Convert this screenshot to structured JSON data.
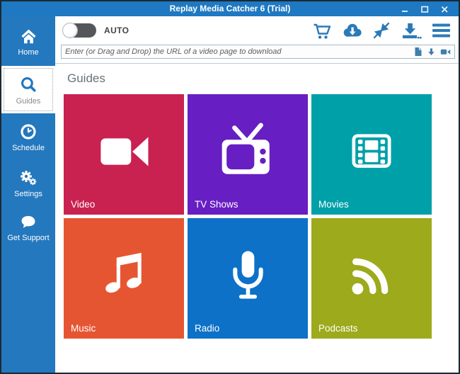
{
  "window": {
    "title": "Replay Media Catcher 6 (Trial)",
    "controls": [
      "minimize",
      "maximize",
      "close"
    ]
  },
  "sidebar": {
    "items": [
      {
        "label": "Home",
        "icon": "home-icon",
        "selected": false
      },
      {
        "label": "Guides",
        "icon": "search-icon",
        "selected": true
      },
      {
        "label": "Schedule",
        "icon": "clock-icon",
        "selected": false
      },
      {
        "label": "Settings",
        "icon": "gears-icon",
        "selected": false
      },
      {
        "label": "Get Support",
        "icon": "speech-bubble-icon",
        "selected": false
      }
    ]
  },
  "toolbar": {
    "auto_label": "AUTO",
    "auto_toggle_on": false,
    "icons": [
      "shopping-cart-icon",
      "cloud-download-icon",
      "shrink-arrows-icon",
      "download-tray-icon",
      "hamburger-menu-icon"
    ]
  },
  "urlbar": {
    "placeholder": "Enter (or Drag and Drop) the URL of a video page to download",
    "icons": [
      "paste-icon",
      "down-arrow-icon",
      "camcorder-icon"
    ]
  },
  "main": {
    "heading": "Guides",
    "tiles": [
      {
        "label": "Video",
        "color": "#c92150",
        "icon": "video-camera-icon"
      },
      {
        "label": "TV Shows",
        "color": "#671ec3",
        "icon": "tv-icon"
      },
      {
        "label": "Movies",
        "color": "#00a0a9",
        "icon": "film-strip-icon"
      },
      {
        "label": "Music",
        "color": "#e65532",
        "icon": "music-note-icon"
      },
      {
        "label": "Radio",
        "color": "#0d71c8",
        "icon": "microphone-icon"
      },
      {
        "label": "Podcasts",
        "color": "#9caa1b",
        "icon": "rss-icon"
      }
    ]
  },
  "colors": {
    "titlebar_blue": "#1e79c2",
    "sidebar_blue": "#2478be",
    "toolbar_icon_blue": "#2b7ab8",
    "window_border": "#1a2833"
  }
}
